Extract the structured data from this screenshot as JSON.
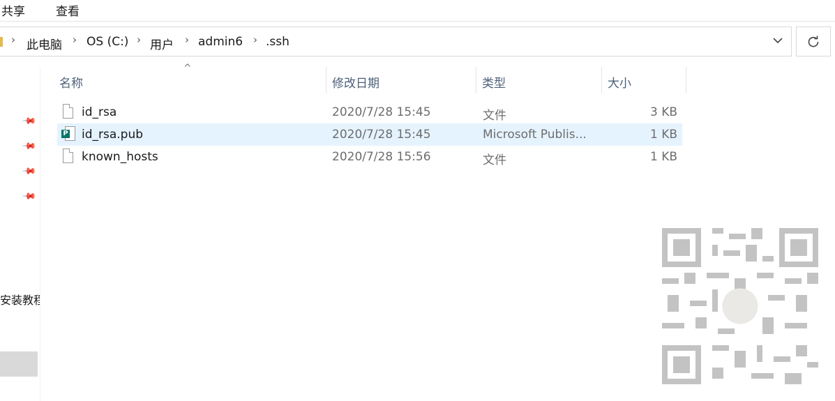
{
  "ribbon": {
    "tabs": [
      "共享",
      "查看"
    ]
  },
  "address": {
    "breadcrumbs": [
      "此电脑",
      "OS (C:)",
      "用户",
      "admin6",
      ".ssh"
    ],
    "dropdown_icon": "chevron-down-icon",
    "refresh_icon": "refresh-icon"
  },
  "nav": {
    "pinned_count": 4,
    "label": "安装教程"
  },
  "columns": {
    "name": "名称",
    "date": "修改日期",
    "type": "类型",
    "size": "大小"
  },
  "files": [
    {
      "name": "id_rsa",
      "date": "2020/7/28 15:45",
      "type": "文件",
      "size": "3 KB",
      "icon": "file-icon"
    },
    {
      "name": "id_rsa.pub",
      "date": "2020/7/28 15:45",
      "type": "Microsoft Publis...",
      "size": "1 KB",
      "icon": "publisher-file-icon"
    },
    {
      "name": "known_hosts",
      "date": "2020/7/28 15:56",
      "type": "文件",
      "size": "1 KB",
      "icon": "file-icon"
    }
  ],
  "colors": {
    "selected_row": "#e5f3ff",
    "header_text": "#4c607a"
  }
}
